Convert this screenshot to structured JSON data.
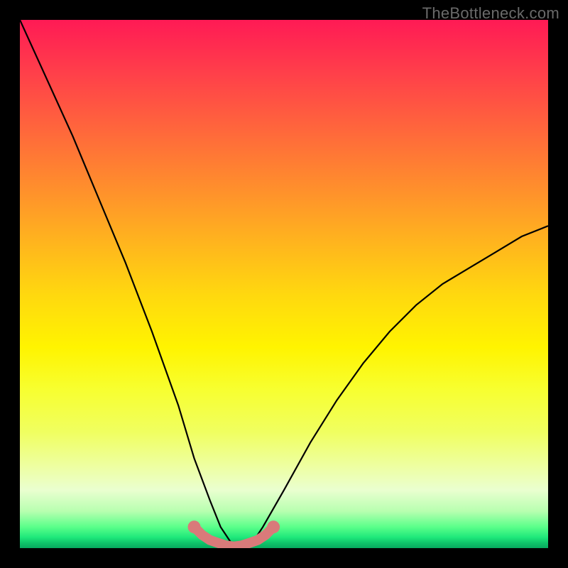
{
  "watermark": {
    "text": "TheBottleneck.com"
  },
  "chart_data": {
    "type": "line",
    "title": "",
    "xlabel": "",
    "ylabel": "",
    "xlim": [
      0,
      100
    ],
    "ylim": [
      0,
      100
    ],
    "series": [
      {
        "name": "bottleneck-curve",
        "x": [
          0,
          5,
          10,
          15,
          20,
          25,
          30,
          33,
          36,
          38,
          40,
          42,
          44,
          46,
          50,
          55,
          60,
          65,
          70,
          75,
          80,
          85,
          90,
          95,
          100
        ],
        "values": [
          100,
          89,
          78,
          66,
          54,
          41,
          27,
          17,
          9,
          4,
          1,
          0,
          1,
          4,
          11,
          20,
          28,
          35,
          41,
          46,
          50,
          53,
          56,
          59,
          61
        ]
      }
    ],
    "markers": {
      "name": "floor-markers",
      "color": "#d97a7a",
      "x": [
        33,
        34.5,
        36,
        37.5,
        39,
        40.5,
        42,
        43.5,
        45,
        46.5,
        48
      ],
      "values": [
        4,
        2.5,
        1.5,
        1,
        0.5,
        0.3,
        0.5,
        1,
        1.5,
        2.5,
        4
      ]
    }
  },
  "colors": {
    "curve": "#000000",
    "marker": "#d97a7a",
    "frame": "#000000"
  }
}
